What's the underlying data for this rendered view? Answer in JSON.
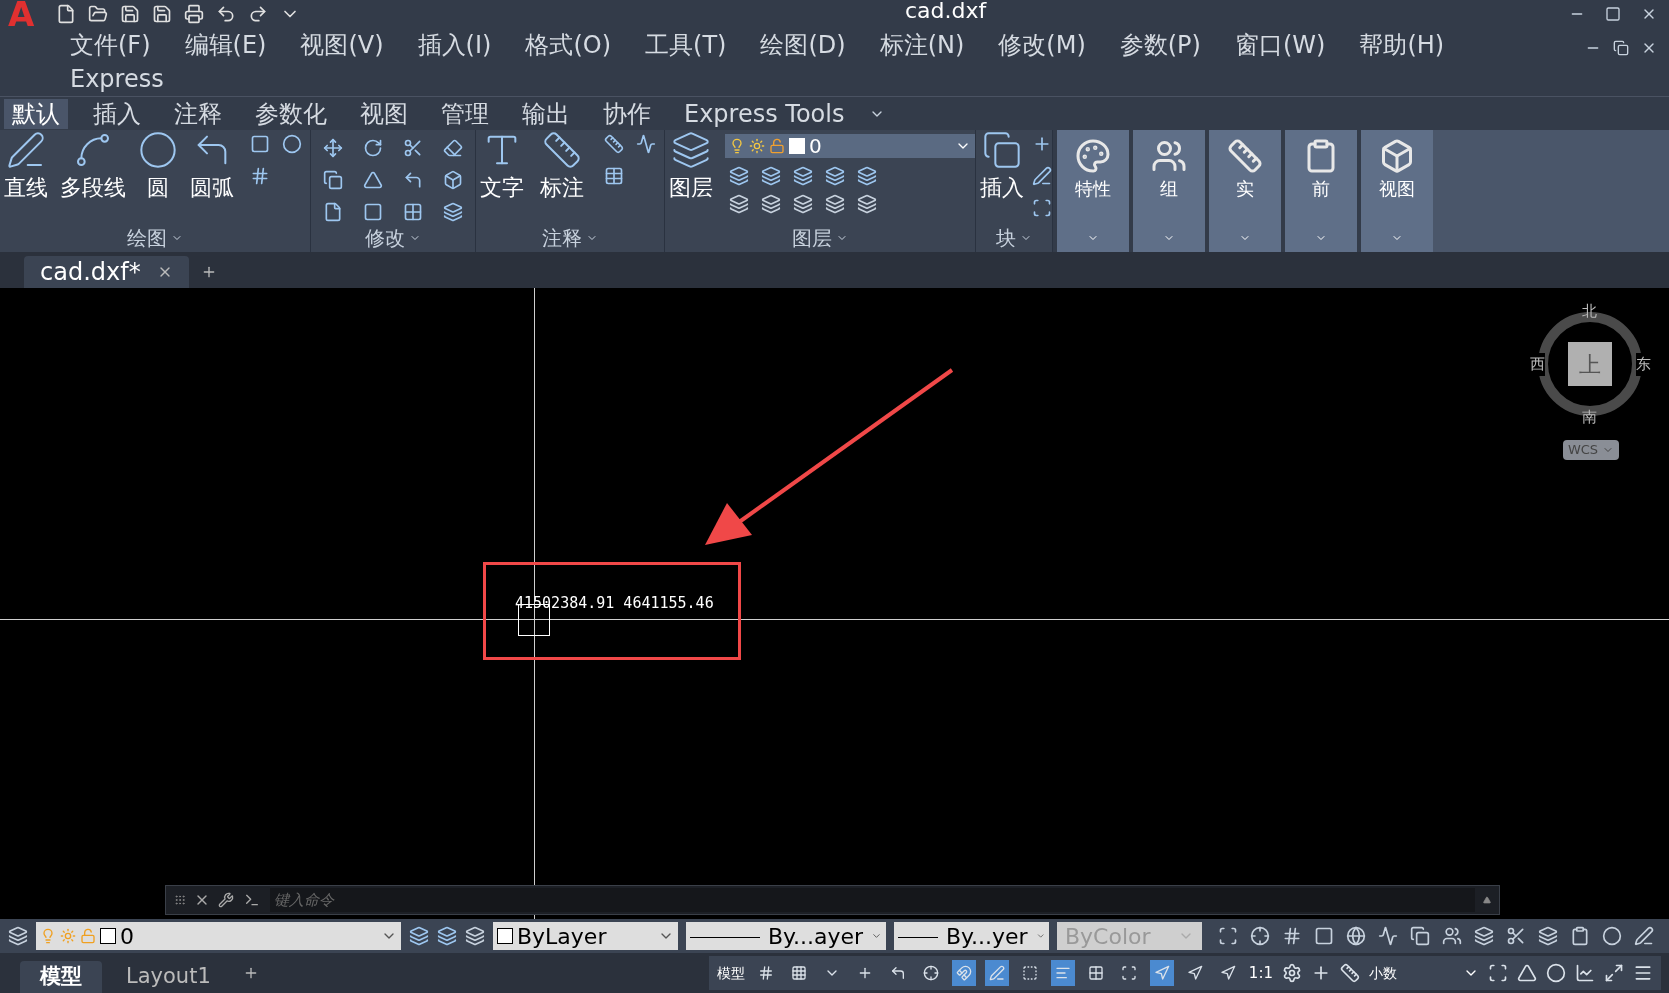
{
  "title_bar": {
    "app_logo": "A",
    "title": "cad.dxf"
  },
  "menu_bar": {
    "items": [
      "文件(F)",
      "编辑(E)",
      "视图(V)",
      "插入(I)",
      "格式(O)",
      "工具(T)",
      "绘图(D)",
      "标注(N)",
      "修改(M)",
      "参数(P)",
      "窗口(W)",
      "帮助(H)",
      "Express"
    ]
  },
  "ribbon_tabs": [
    {
      "label": "默认",
      "selected": true
    },
    {
      "label": "插入",
      "selected": false
    },
    {
      "label": "注释",
      "selected": false
    },
    {
      "label": "参数化",
      "selected": false
    },
    {
      "label": "视图",
      "selected": false
    },
    {
      "label": "管理",
      "selected": false
    },
    {
      "label": "输出",
      "selected": false
    },
    {
      "label": "协作",
      "selected": false
    },
    {
      "label": "Express Tools",
      "selected": false
    }
  ],
  "ribbon_panels": [
    {
      "kind": "draw",
      "label": "绘图",
      "buttons": [
        "直线",
        "多段线",
        "圆",
        "圆弧"
      ]
    },
    {
      "kind": "modify",
      "label": "修改"
    },
    {
      "kind": "annotate",
      "label": "注释",
      "buttons": [
        "文字",
        "标注"
      ]
    },
    {
      "kind": "layers",
      "label": "图层",
      "buttons": [
        "图层"
      ],
      "layer": "0"
    },
    {
      "kind": "block",
      "label": "块",
      "buttons": [
        "插入"
      ]
    }
  ],
  "ribbon_flyouts": [
    "特性",
    "组",
    "实",
    "前",
    "视图"
  ],
  "document_tabs": [
    {
      "label": "cad.dxf*",
      "selected": true
    }
  ],
  "viewcube": {
    "north": "北",
    "south": "南",
    "east": "东",
    "west": "西",
    "face": "上",
    "coordinate_system": "WCS"
  },
  "canvas": {
    "cursor_coordinates": "41502384.91 4641155.46"
  },
  "command_line": {
    "placeholder": "键入命令"
  },
  "properties_bar": {
    "layer": "0",
    "color_setting": "ByLayer",
    "linetype": "By...ayer",
    "lineweight": "By...yer",
    "plot_style": {
      "label": "ByColor",
      "disabled": true
    }
  },
  "layout_tabs": [
    {
      "label": "模型",
      "selected": true
    },
    {
      "label": "Layout1",
      "selected": false
    }
  ],
  "status_bar": {
    "space": "模型",
    "scale": "1:1",
    "units": "小数",
    "toggles": [
      {
        "on": false
      },
      {
        "on": false
      },
      {
        "on": false
      },
      {
        "on": false
      },
      {
        "on": false
      },
      {
        "on": false
      },
      {
        "on": true
      },
      {
        "on": true
      },
      {
        "on": false
      },
      {
        "on": true
      },
      {
        "on": false
      },
      {
        "on": false
      },
      {
        "on": true
      },
      {
        "on": false
      },
      {
        "on": false
      }
    ]
  }
}
